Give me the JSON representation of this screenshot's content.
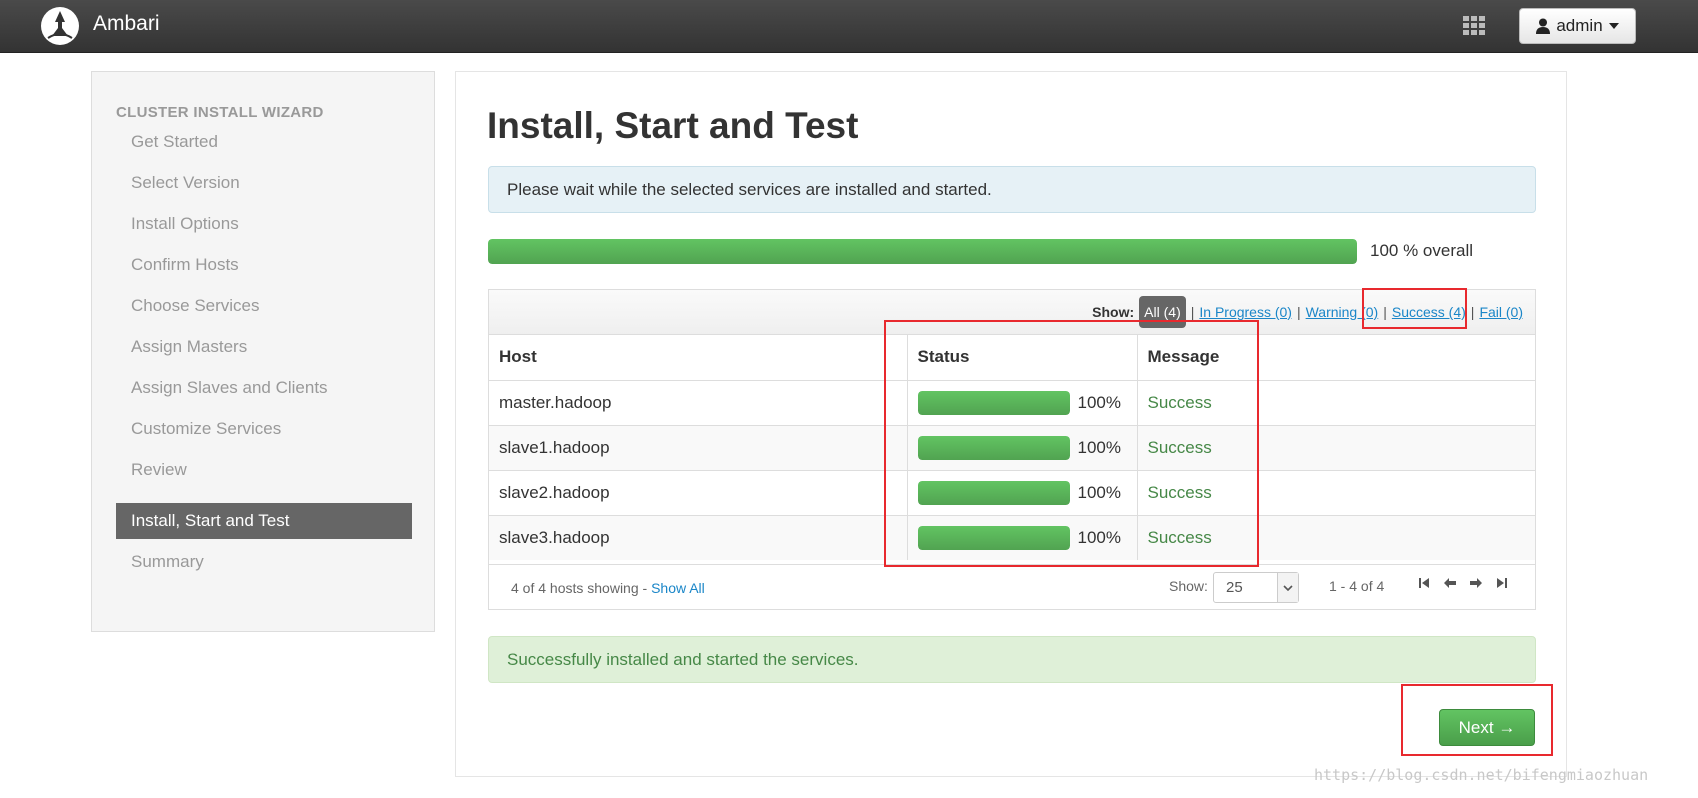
{
  "navbar": {
    "brand": "Ambari",
    "user_label": "admin"
  },
  "sidebar": {
    "title": "CLUSTER INSTALL WIZARD",
    "steps": [
      {
        "label": "Get Started"
      },
      {
        "label": "Select Version"
      },
      {
        "label": "Install Options"
      },
      {
        "label": "Confirm Hosts"
      },
      {
        "label": "Choose Services"
      },
      {
        "label": "Assign Masters"
      },
      {
        "label": "Assign Slaves and Clients"
      },
      {
        "label": "Customize Services"
      },
      {
        "label": "Review"
      },
      {
        "label": "Install, Start and Test",
        "active": true
      },
      {
        "label": "Summary"
      }
    ]
  },
  "main": {
    "title": "Install, Start and Test",
    "info_message": "Please wait while the selected services are installed and started.",
    "overall_progress": 1.0,
    "overall_text": "100 % overall",
    "filters": {
      "show_label": "Show:",
      "all": "All (4)",
      "in_progress": "In Progress (0)",
      "warning": "Warning (0)",
      "success": "Success (4)",
      "fail": "Fail (0)"
    },
    "table": {
      "headers": {
        "host": "Host",
        "status": "Status",
        "message": "Message"
      },
      "rows": [
        {
          "host": "master.hadoop",
          "progress": 1.0,
          "percent": "100%",
          "message": "Success"
        },
        {
          "host": "slave1.hadoop",
          "progress": 1.0,
          "percent": "100%",
          "message": "Success"
        },
        {
          "host": "slave2.hadoop",
          "progress": 1.0,
          "percent": "100%",
          "message": "Success"
        },
        {
          "host": "slave3.hadoop",
          "progress": 1.0,
          "percent": "100%",
          "message": "Success"
        }
      ]
    },
    "footer": {
      "hosts_showing": "4 of 4 hosts showing - ",
      "show_all": "Show All",
      "page_size_label": "Show:",
      "page_size": "25",
      "page_range": "1 - 4 of 4"
    },
    "success_message": "Successfully installed and started the services.",
    "next_label": "Next →"
  },
  "colors": {
    "success_green": "#51a351",
    "annotation_red": "#e8292e",
    "link_blue": "#1a86c8"
  },
  "watermark": "https://blog.csdn.net/bifengmiaozhuan"
}
